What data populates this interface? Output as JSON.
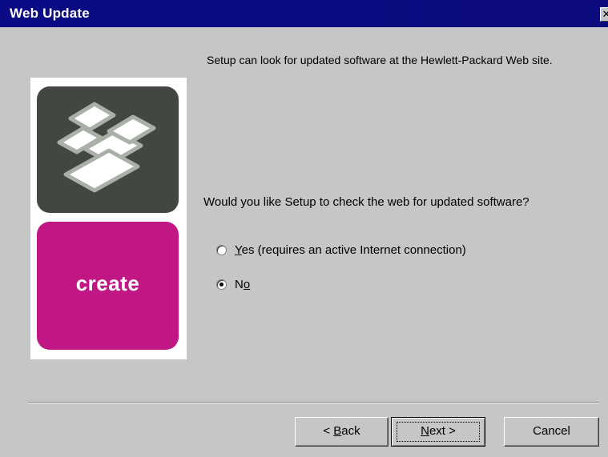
{
  "window": {
    "title": "Web Update",
    "close_glyph": "✕"
  },
  "branding": {
    "create_label": "create",
    "colors": {
      "dark_tile": "#424841",
      "magenta_tile": "#c01784"
    },
    "icon": "hp-stacked-tiles-logo"
  },
  "content": {
    "intro": "Setup can look for updated software at the Hewlett-Packard Web site.",
    "question": "Would you like Setup to check the web for updated software?"
  },
  "options": {
    "yes": {
      "mnemonic": "Y",
      "rest": "es (requires an active Internet connection)",
      "checked": false
    },
    "no": {
      "prefix": "N",
      "mnemonic": "o",
      "checked": true
    }
  },
  "buttons": {
    "back": {
      "prefix": "< ",
      "mnemonic": "B",
      "rest": "ack"
    },
    "next": {
      "mnemonic": "N",
      "rest": "ext >"
    },
    "cancel": "Cancel"
  }
}
